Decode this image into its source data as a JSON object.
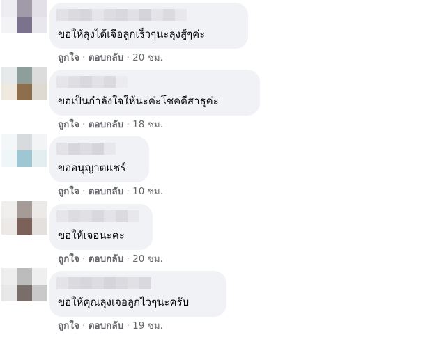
{
  "comments": [
    {
      "text": "ขอให้ลุงได้เจือลูกเร็วๆนะลุงสู้ๆค่ะ",
      "like": "ถูกใจ",
      "reply": "ตอบกลับ",
      "time": "20 ชม.",
      "avatar_colors": [
        "#eeeef2",
        "#a19aa8",
        "#e4e0e8",
        "#f3f3f6",
        "#7b738e",
        "#e9e7ee"
      ],
      "name_colors": [
        "#e2e2e6",
        "#dadadf",
        "#d6d6dc",
        "#e6e6ea",
        "#dcdce1",
        "#d8d8de",
        "#e0e0e5",
        "#d4d4da",
        "#e4e4e8",
        "#dadadf",
        "#e8e8ec"
      ]
    },
    {
      "text": "ขอเป็นกำลังใจให้นะค่ะโชคดีสาธุค่ะ",
      "like": "ถูกใจ",
      "reply": "ตอบกลับ",
      "time": "18 ชม.",
      "avatar_colors": [
        "#e7eaea",
        "#8e9e9a",
        "#dcdcdc",
        "#f0e9e0",
        "#8d6f4d",
        "#dedad2"
      ],
      "name_colors": [
        "#e6e6ea",
        "#dedee3",
        "#d8d8de",
        "#e2e2e6",
        "#dadadf",
        "#ececef"
      ]
    },
    {
      "text": "ขออนุญาตแชร์",
      "like": "ถูกใจ",
      "reply": "ตอบกลับ",
      "time": "10 ชม.",
      "avatar_colors": [
        "#f4f7f8",
        "#d8dbdd",
        "#f2f4f5",
        "#eef6f8",
        "#9fc7d3",
        "#e3eef0"
      ],
      "name_colors": [
        "#e3e3e7",
        "#d6d6dc",
        "#dcdce1",
        "#d4d4da",
        "#e8e8ec"
      ]
    },
    {
      "text": "ขอให้เจอนะคะ",
      "like": "ถูกใจ",
      "reply": "ตอบกลับ",
      "time": "20 ชม.",
      "avatar_colors": [
        "#f1efed",
        "#a59c97",
        "#eceae8",
        "#ece9e7",
        "#7c6159",
        "#e4e0de"
      ],
      "name_colors": [
        "#e6e6ea",
        "#dcdce1",
        "#e0e0e5",
        "#d8d8de",
        "#e4e4e8",
        "#dadadf",
        "#e8e8ec"
      ]
    },
    {
      "text": "ขอให้คุณลุงเจอลูกไวๆนะครับ",
      "like": "ถูกใจ",
      "reply": "ตอบกลับ",
      "time": "19 ชม.",
      "avatar_colors": [
        "#eeeeee",
        "#bcbcbc",
        "#efefef",
        "#e8e8e8",
        "#7a6e6a",
        "#c9c9c9"
      ],
      "name_colors": [
        "#e4e4e8",
        "#dadadf",
        "#d6d6dc",
        "#dcdce1",
        "#d4d4da",
        "#dadadf",
        "#e0e0e5",
        "#d8d8de"
      ]
    }
  ],
  "separator": "·"
}
